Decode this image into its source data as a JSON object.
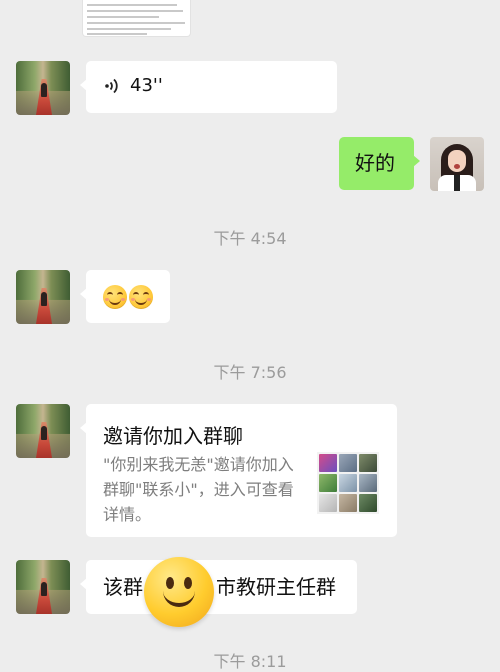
{
  "chat": {
    "messages": [
      {
        "sender": "other",
        "type": "voice",
        "duration": "43''"
      },
      {
        "sender": "self",
        "type": "text",
        "text": "好的"
      },
      {
        "type": "timestamp",
        "text": "下午 4:54"
      },
      {
        "sender": "other",
        "type": "emoji",
        "emojis": [
          "smiling-face-icon",
          "smiling-face-icon"
        ]
      },
      {
        "type": "timestamp",
        "text": "下午 7:56"
      },
      {
        "sender": "other",
        "type": "group-invite",
        "title": "邀请你加入群聊",
        "description": "\"你别来我无恙\"邀请你加入群聊\"联系小\"，进入可查看详情。"
      },
      {
        "sender": "other",
        "type": "text",
        "text_before": "该群",
        "text_after": "市教研主任群"
      },
      {
        "type": "timestamp",
        "text": "下午 8:11"
      }
    ]
  },
  "colors": {
    "background": "#ededed",
    "self_bubble": "#95ec69",
    "other_bubble": "#ffffff",
    "timestamp": "#9b9b9b"
  },
  "icons": {
    "voice": "voice-wave-icon",
    "overlay": "smiley-sticker"
  }
}
